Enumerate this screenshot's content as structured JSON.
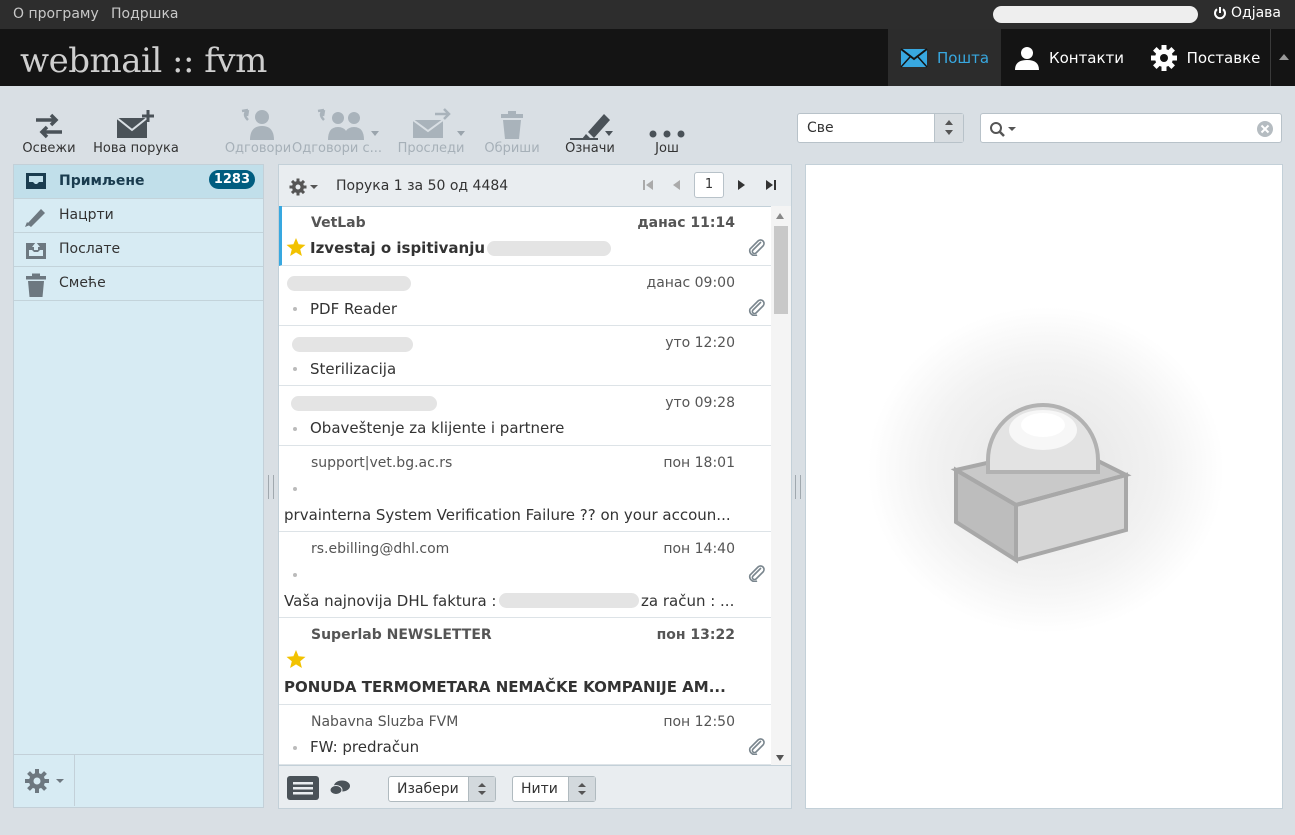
{
  "topbar": {
    "about": "О програму",
    "support": "Подршка",
    "logout": "Одјава"
  },
  "header": {
    "logo": "webmail :: fvm",
    "nav": [
      {
        "label": "Пошта",
        "icon": "envelope-icon",
        "active": true
      },
      {
        "label": "Контакти",
        "icon": "person-icon",
        "active": false
      },
      {
        "label": "Поставке",
        "icon": "gear-icon",
        "active": false
      }
    ]
  },
  "toolbar": {
    "refresh": "Освежи",
    "compose": "Нова порука",
    "reply": "Одговори",
    "reply_all": "Одговори с...",
    "forward": "Проследи",
    "delete": "Обриши",
    "mark": "Означи",
    "more": "Још"
  },
  "filter": {
    "selected": "Све"
  },
  "folders": {
    "items": [
      {
        "name": "Примљене",
        "badge": "1283",
        "icon": "inbox-icon",
        "selected": true
      },
      {
        "name": "Нацрти",
        "icon": "pencil-icon"
      },
      {
        "name": "Послате",
        "icon": "sent-icon"
      },
      {
        "name": "Смеће",
        "icon": "trash-icon"
      }
    ]
  },
  "list": {
    "count": "Порука 1 за 50 од 4484",
    "page": "1",
    "messages": [
      {
        "from": "VetLab",
        "date": "данас 11:14",
        "subject": "Izvestaj o ispitivanju",
        "unread": true,
        "flagged": true,
        "attachment": true
      },
      {
        "from": "",
        "date": "данас 09:00",
        "subject": "PDF Reader",
        "attachment": true
      },
      {
        "from": "",
        "date": "уто 12:20",
        "subject": "Sterilizacija"
      },
      {
        "from": "",
        "date": "уто 09:28",
        "subject": "Obaveštenje za klijente i partnere"
      },
      {
        "from": "support|vet.bg.ac.rs",
        "date": "пон 18:01",
        "subject": "prvainterna System Verification Failure ?? on your accoun..."
      },
      {
        "from": "rs.ebilling@dhl.com",
        "date": "пон 14:40",
        "subject": "Vaša najnovija DHL faktura :",
        "subject_tail": "za račun : ...",
        "attachment": true
      },
      {
        "from": "Superlab NEWSLETTER",
        "date": "пон 13:22",
        "subject": "PONUDA TERMOMETARA NEMAČKE KOMPANIJE AM...",
        "unread": true,
        "flagged": true
      },
      {
        "from": "Nabavna Sluzba FVM",
        "date": "пон 12:50",
        "subject": "FW: predračun",
        "attachment": true
      }
    ]
  },
  "listfooter": {
    "select": "Изабери",
    "threads": "Нити"
  },
  "colors": {
    "accent": "#38a8e0",
    "header_bg": "#141414",
    "badge": "#005d80",
    "folder_bg": "#d7ebf3"
  }
}
